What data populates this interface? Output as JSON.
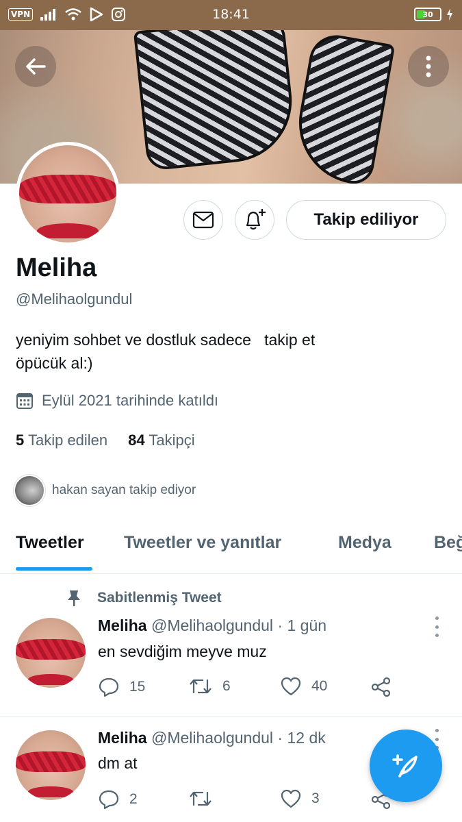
{
  "status_bar": {
    "vpn": "VPN",
    "time": "18:41",
    "battery": "30"
  },
  "profile": {
    "name": "Meliha",
    "handle": "@Melihaolgundul",
    "bio": "yeniyim sohbet ve dostluk sadece   takip et\nöpücük al:)",
    "joined": "Eylül 2021 tarihinde katıldı",
    "following_count": "5",
    "following_label": "Takip edilen",
    "followers_count": "84",
    "followers_label": "Takipçi",
    "followed_by": "hakan sayan takip ediyor",
    "follow_button": "Takip ediliyor"
  },
  "tabs": [
    {
      "label": "Tweetler",
      "active": true
    },
    {
      "label": "Tweetler ve yanıtlar",
      "active": false
    },
    {
      "label": "Medya",
      "active": false
    },
    {
      "label": "Beğ",
      "active": false
    }
  ],
  "pinned_label": "Sabitlenmiş Tweet",
  "tweets": [
    {
      "name": "Meliha",
      "meta": "@Melihaolgundul · 1 gün",
      "text": "en sevdiğim meyve muz",
      "replies": "15",
      "retweets": "6",
      "likes": "40"
    },
    {
      "name": "Meliha",
      "meta": "@Melihaolgundul · 12 dk",
      "text": "dm at",
      "replies": "2",
      "retweets": "",
      "likes": "3"
    }
  ],
  "colors": {
    "accent": "#1d9bf0",
    "secondary_text": "#536471",
    "status_bar": "#8a6a4a"
  },
  "icons": [
    "back-arrow-icon",
    "more-vertical-icon",
    "mail-icon",
    "bell-plus-icon",
    "calendar-icon",
    "pin-icon",
    "reply-icon",
    "retweet-icon",
    "like-icon",
    "share-icon",
    "compose-icon"
  ]
}
